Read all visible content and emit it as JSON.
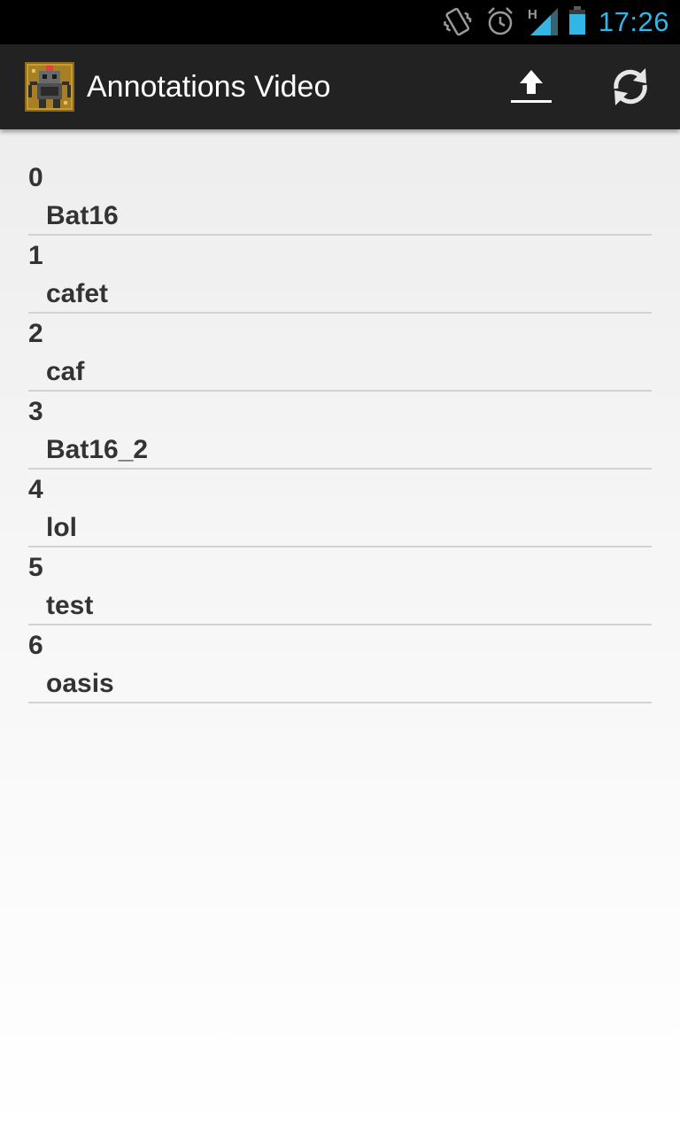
{
  "status_bar": {
    "time": "17:26",
    "network_type": "H",
    "accent_color": "#33b5e5",
    "icons": [
      "vibrate-icon",
      "alarm-icon",
      "signal-icon",
      "battery-icon"
    ]
  },
  "action_bar": {
    "title": "Annotations Video",
    "app_icon": "robot-app-icon",
    "actions": [
      {
        "icon": "upload-icon"
      },
      {
        "icon": "refresh-icon"
      }
    ]
  },
  "list": {
    "items": [
      {
        "index": "0",
        "name": "Bat16"
      },
      {
        "index": "1",
        "name": "cafet"
      },
      {
        "index": "2",
        "name": "caf"
      },
      {
        "index": "3",
        "name": "Bat16_2"
      },
      {
        "index": "4",
        "name": "lol"
      },
      {
        "index": "5",
        "name": "test"
      },
      {
        "index": "6",
        "name": "oasis"
      }
    ]
  }
}
